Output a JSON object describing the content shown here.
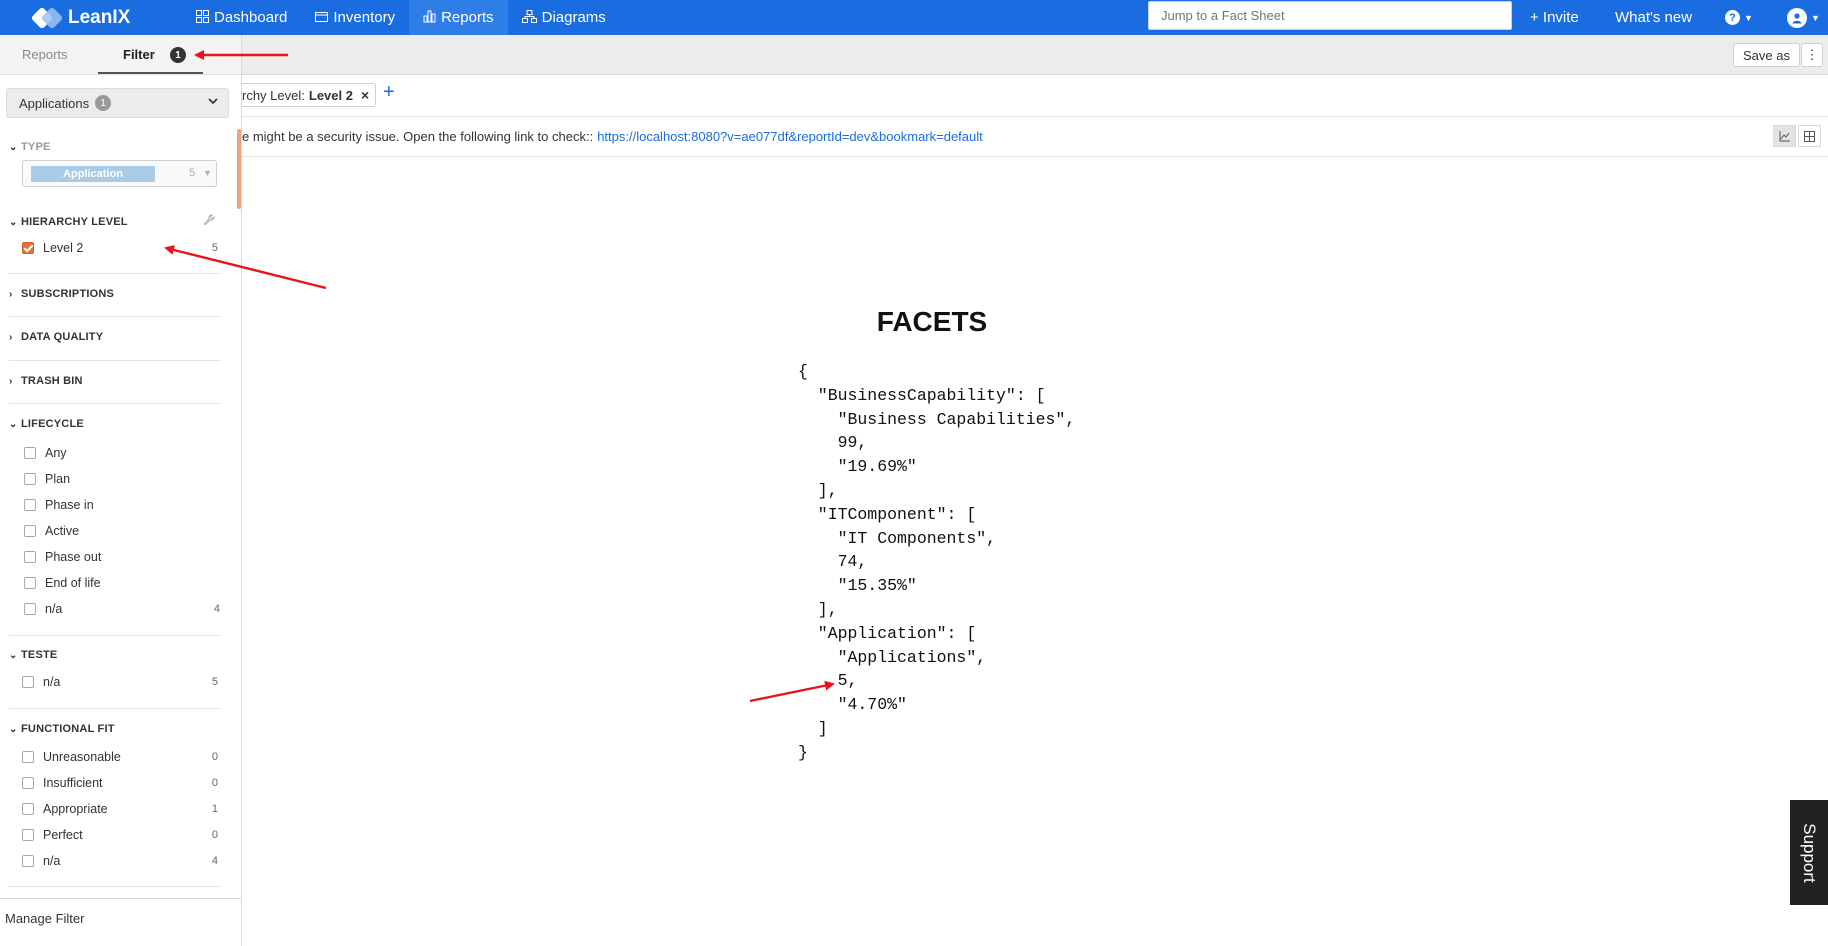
{
  "app": {
    "brand": "LeanIX"
  },
  "nav": {
    "items": [
      {
        "label": "Dashboard",
        "icon": "dashboard-icon"
      },
      {
        "label": "Inventory",
        "icon": "inventory-icon"
      },
      {
        "label": "Reports",
        "icon": "reports-icon",
        "active": true
      },
      {
        "label": "Diagrams",
        "icon": "diagrams-icon"
      }
    ],
    "search_placeholder": "Jump to a Fact Sheet",
    "invite": "+ Invite",
    "whats_new": "What's new"
  },
  "toolbar": {
    "save_as": "Save as"
  },
  "sidebar": {
    "tabs": {
      "reports": "Reports",
      "filter": "Filter",
      "filter_count": "1"
    },
    "type_dropdown": {
      "label": "Applications",
      "count": "1"
    },
    "type_section": {
      "title": "TYPE",
      "tag": "Application",
      "count": "5"
    },
    "hierarchy": {
      "title": "HIERARCHY LEVEL",
      "item": {
        "label": "Level 2",
        "count": "5",
        "checked": true
      }
    },
    "collapsed_sections": [
      "SUBSCRIPTIONS",
      "DATA QUALITY",
      "TRASH BIN"
    ],
    "lifecycle": {
      "title": "LIFECYCLE",
      "items": [
        {
          "label": "Any",
          "count": ""
        },
        {
          "label": "Plan",
          "count": ""
        },
        {
          "label": "Phase in",
          "count": ""
        },
        {
          "label": "Active",
          "count": ""
        },
        {
          "label": "Phase out",
          "count": ""
        },
        {
          "label": "End of life",
          "count": ""
        },
        {
          "label": "n/a",
          "count": "4"
        }
      ]
    },
    "teste": {
      "title": "TESTE",
      "items": [
        {
          "label": "n/a",
          "count": "5"
        }
      ]
    },
    "functional_fit": {
      "title": "FUNCTIONAL FIT",
      "items": [
        {
          "label": "Unreasonable",
          "count": "0"
        },
        {
          "label": "Insufficient",
          "count": "0"
        },
        {
          "label": "Appropriate",
          "count": "1"
        },
        {
          "label": "Perfect",
          "count": "0"
        },
        {
          "label": "n/a",
          "count": "4"
        }
      ]
    },
    "manage_filter": "Manage Filter"
  },
  "chipbar": {
    "chip_prefix": "rchy Level:",
    "chip_value": "Level 2",
    "close": "×",
    "add": "+"
  },
  "notice": {
    "text": "e might be a security issue. Open the following link to check::",
    "link": "https://localhost:8080?v=ae077df&reportId=dev&bookmark=default"
  },
  "report": {
    "title": "FACETS",
    "json_text": "{\n  \"BusinessCapability\": [\n    \"Business Capabilities\",\n    99,\n    \"19.69%\"\n  ],\n  \"ITComponent\": [\n    \"IT Components\",\n    74,\n    \"15.35%\"\n  ],\n  \"Application\": [\n    \"Applications\",\n    5,\n    \"4.70%\"\n  ]\n}"
  },
  "support": {
    "label": "Support"
  },
  "colors": {
    "nav_bg": "#1a6de0",
    "accent_orange": "#e0733f",
    "annotation_red": "#e8141b"
  }
}
